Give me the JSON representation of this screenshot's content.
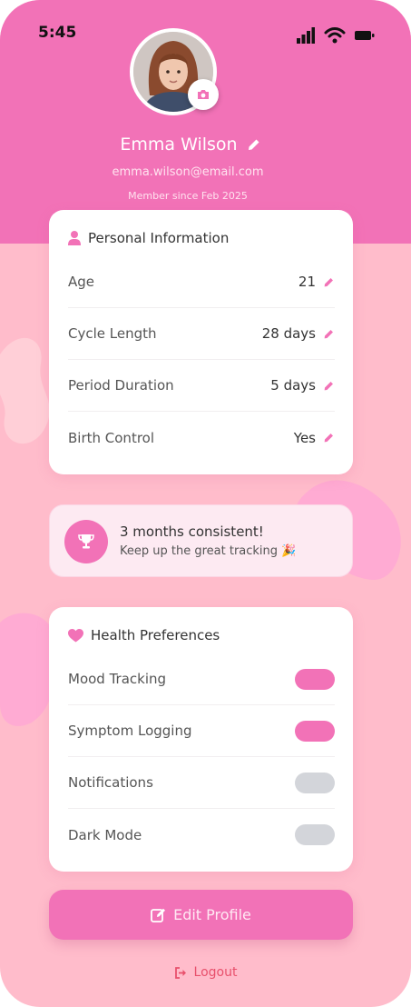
{
  "status": {
    "time": "5:45"
  },
  "profile": {
    "name": "Emma Wilson",
    "email": "emma.wilson@email.com",
    "member_since": "Member since Feb 2025"
  },
  "personal": {
    "title": "Personal Information",
    "rows": [
      {
        "label": "Age",
        "value": "21"
      },
      {
        "label": "Cycle Length",
        "value": "28 days"
      },
      {
        "label": "Period Duration",
        "value": "5 days"
      },
      {
        "label": "Birth Control",
        "value": "Yes"
      }
    ]
  },
  "achievement": {
    "title": "3 months consistent!",
    "subtitle": "Keep up the great tracking 🎉"
  },
  "health": {
    "title": "Health Preferences",
    "rows": [
      {
        "label": "Mood Tracking",
        "on": true
      },
      {
        "label": "Symptom Logging",
        "on": true
      },
      {
        "label": "Notifications",
        "on": false
      },
      {
        "label": "Dark Mode",
        "on": false
      }
    ]
  },
  "actions": {
    "edit_label": "Edit Profile",
    "logout_label": "Logout"
  },
  "colors": {
    "primary": "#f272b7",
    "background": "#ffbccb",
    "toggle_off": "#d3d5da",
    "logout": "#e8506c"
  },
  "icons": {
    "status": [
      "signal-icon",
      "wifi-icon",
      "battery-icon"
    ],
    "camera": "camera-icon",
    "edit": "pencil-icon",
    "person": "person-icon",
    "heart": "heart-icon",
    "trophy": "trophy-icon",
    "logout": "logout-icon"
  }
}
